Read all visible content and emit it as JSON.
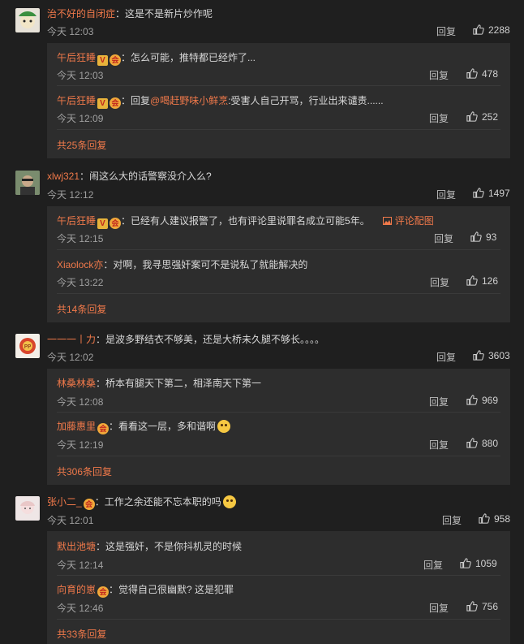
{
  "labels": {
    "reply": "回复"
  },
  "comments": [
    {
      "name": "治不好的自闭症",
      "text": "：这是不是新片炒作呢",
      "time": "今天 12:03",
      "likes": "2288",
      "replies": [
        {
          "name": "午后狂睡",
          "text": "：怎么可能，推特都已经炸了...",
          "time": "今天 12:03",
          "likes": "478"
        },
        {
          "name": "午后狂睡",
          "text_prefix": "：回复",
          "mention": "@喝赶野味小鲜烹",
          "text": ":受害人自己开骂，行业出来谴责......",
          "time": "今天 12:09",
          "likes": "252"
        }
      ],
      "more": "共25条回复"
    },
    {
      "name": "xlwj321",
      "text": "：闹这么大的话警察没介入么?",
      "time": "今天 12:12",
      "likes": "1497",
      "replies": [
        {
          "name": "午后狂睡",
          "text": "：已经有人建议报警了，也有评论里说罪名成立可能5年。",
          "pic": "评论配图",
          "time": "今天 12:15",
          "likes": "93"
        },
        {
          "name": "Xiaolock亦",
          "text": "：对啊，我寻思强奸案可不是说私了就能解决的",
          "time": "今天 13:22",
          "likes": "126"
        }
      ],
      "more": "共14条回复"
    },
    {
      "name": "一一一丨力",
      "text": "：是波多野结衣不够美，还是大桥未久腿不够长。。。。",
      "time": "今天 12:02",
      "likes": "3603",
      "replies": [
        {
          "name": "林桑林桑",
          "text": "：桥本有腿天下第二，相泽南天下第一",
          "time": "今天 12:08",
          "likes": "969"
        },
        {
          "name": "加藤惠里",
          "text": "：看看这一层，多和谐啊",
          "time": "今天 12:19",
          "likes": "880"
        }
      ],
      "more": "共306条回复"
    },
    {
      "name": "张小二_",
      "text": "：工作之余还能不忘本职的吗",
      "time": "今天 12:01",
      "likes": "958",
      "replies": [
        {
          "name": "默出池塘",
          "text": "：这是强奸，不是你抖机灵的时候",
          "time": "今天 12:14",
          "likes": "1059"
        },
        {
          "name": "向育的崽",
          "text": "：觉得自己很幽默? 这是犯罪",
          "time": "今天 12:46",
          "likes": "756"
        }
      ],
      "more": "共33条回复"
    }
  ],
  "colors": {
    "background": "#1f1f1f",
    "reply_box": "#2d2d2d",
    "name": "#f0794a"
  },
  "icons": [
    "thumbs-up-icon",
    "image-icon",
    "vip-v-badge",
    "member-badge",
    "smile-emoji"
  ]
}
